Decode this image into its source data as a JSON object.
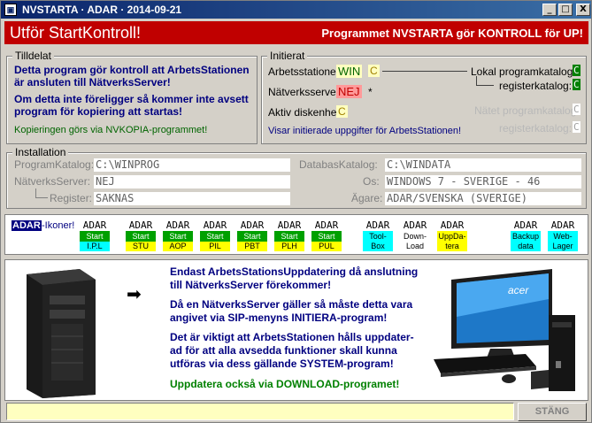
{
  "window": {
    "title": "NVSTARTA · ADAR · 2014-09-21",
    "min_label": "_",
    "max_label": "□",
    "close_label": "X"
  },
  "header": {
    "title": "Utför StartKontroll!",
    "right_text": "Programmet NVSTARTA gör KONTROLL för UP!"
  },
  "tilldelat": {
    "legend": "Tilldelat",
    "line1": "Detta program gör kontroll att ArbetsStationen",
    "line2": "är ansluten till NätverksServer!",
    "line3": "Om detta inte föreligger så kommer inte avsett",
    "line4": "program för kopiering att startas!",
    "line5": "Kopieringen görs via NVKOPIA-programmet!"
  },
  "initierat": {
    "legend": "Initierat",
    "arb_label": "Arbetsstationen:",
    "arb_value": "WIN",
    "arb_drive": "C",
    "nat_label": "Nätverksserver:",
    "nat_value": "NEJ",
    "nat_drive": "*",
    "disk_label": "Aktiv diskenhet:",
    "disk_value": "C",
    "lok_label": "Lokal programkatalog:",
    "lok_value": "C",
    "reg_label": "registerkatalog:",
    "reg_value": "C",
    "net_label": "Nätet programkatalog:",
    "net_value": "C",
    "netreg_label": "registerkatalog:",
    "netreg_value": "C",
    "footer": "Visar initierade uppgifter för ArbetsStationen!"
  },
  "installation": {
    "legend": "Installation",
    "prog_label": "ProgramKatalog:",
    "prog_value": "C:\\WINPROG",
    "nat_label": "NätverksServer:",
    "nat_value": "NEJ",
    "reg_label": "Register:",
    "reg_value": "SAKNAS",
    "db_label": "DatabasKatalog:",
    "db_value": "C:\\WINDATA",
    "os_label": "Os:",
    "os_value": "WINDOWS 7 - SVERIGE - 46",
    "owner_label": "Ägare:",
    "owner_value": "ADAR/SVENSKA (SVERIGE)"
  },
  "iconbar": {
    "brand": "ADAR",
    "brand_suffix": "-Ikoner!",
    "icons": [
      {
        "top": "ADAR",
        "mid": "Start",
        "bot": "I.P.L",
        "color": "#00a000",
        "botcolor": "#00ffff"
      },
      {
        "top": "ADAR",
        "mid": "Start",
        "bot": "STU",
        "color": "#00a000",
        "botcolor": "#ffff00"
      },
      {
        "top": "ADAR",
        "mid": "Start",
        "bot": "AOP",
        "color": "#00a000",
        "botcolor": "#ffff00"
      },
      {
        "top": "ADAR",
        "mid": "Start",
        "bot": "PIL",
        "color": "#00a000",
        "botcolor": "#ffff00"
      },
      {
        "top": "ADAR",
        "mid": "Start",
        "bot": "PBT",
        "color": "#00a000",
        "botcolor": "#ffff00"
      },
      {
        "top": "ADAR",
        "mid": "Start",
        "bot": "PLH",
        "color": "#00a000",
        "botcolor": "#ffff00"
      },
      {
        "top": "ADAR",
        "mid": "Start",
        "bot": "PUL",
        "color": "#00a000",
        "botcolor": "#ffff00"
      },
      {
        "top": "ADAR",
        "mid": "Tool-",
        "bot": "Box",
        "color": "#00ffff",
        "botcolor": "#00ffff"
      },
      {
        "top": "ADAR",
        "mid": "Down-",
        "bot": "Load",
        "color": "#ffffff",
        "botcolor": "#ffffff"
      },
      {
        "top": "ADAR",
        "mid": "UppDa-",
        "bot": "tera",
        "color": "#ffff00",
        "botcolor": "#ffff00"
      },
      {
        "top": "ADAR",
        "mid": "Backup",
        "bot": "data",
        "color": "#00ffff",
        "botcolor": "#00ffff"
      },
      {
        "top": "ADAR",
        "mid": "Web-",
        "bot": "Lager",
        "color": "#00ffff",
        "botcolor": "#00ffff"
      }
    ]
  },
  "content": {
    "arrow": "➡",
    "p1a": "Endast ArbetsStationsUppdatering då anslutning",
    "p1b": "till NätverksServer förekommer!",
    "p2a": "Då en NätverksServer gäller så måste detta vara",
    "p2b": "angivet via SIP-menyns INITIERA-program!",
    "p3a": "Det är viktigt att ArbetsStationen hålls uppdater-",
    "p3b": "ad för att alla avsedda funktioner skall kunna",
    "p3c": "utföras via dess gällande SYSTEM-program!",
    "p4": "Uppdatera också via DOWNLOAD-programet!",
    "monitor_brand": "acer"
  },
  "bottom": {
    "close_label": "STÄNG"
  }
}
